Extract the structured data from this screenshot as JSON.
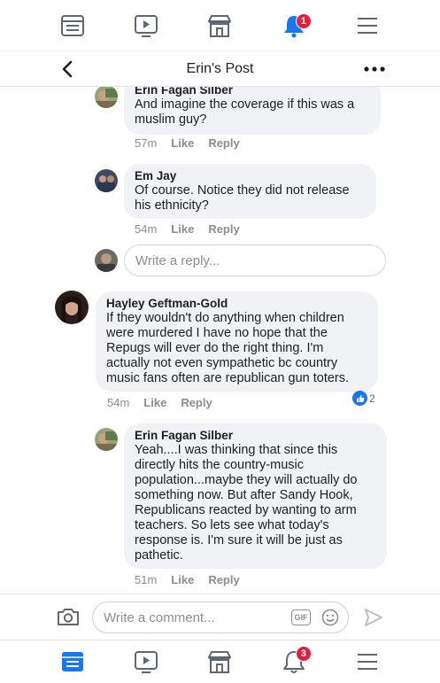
{
  "top_nav": {
    "items": [
      {
        "name": "news-feed",
        "icon": "news-feed-icon",
        "active": false
      },
      {
        "name": "watch",
        "icon": "video-play-icon",
        "active": false
      },
      {
        "name": "marketplace",
        "icon": "marketplace-store-icon",
        "active": false
      },
      {
        "name": "notifications",
        "icon": "bell-icon",
        "active": true,
        "badge": "1"
      },
      {
        "name": "menu",
        "icon": "hamburger-menu-icon",
        "active": false
      }
    ]
  },
  "header": {
    "title": "Erin's Post",
    "back_icon": "chevron-left-icon",
    "more_icon": "more-dots-icon"
  },
  "comments": [
    {
      "author": "Erin Fagan Silber",
      "lines": [
        "And imagine the coverage if this was a",
        "muslim guy?"
      ],
      "time": "57m",
      "like_label": "Like",
      "reply_label": "Reply"
    },
    {
      "author": "Em Jay",
      "lines": [
        "Of course. Notice they did not release",
        "his ethnicity?"
      ],
      "time": "54m",
      "like_label": "Like",
      "reply_label": "Reply"
    },
    {
      "author": "Hayley Geftman-Gold",
      "lines": [
        "If they wouldn't do anything when children",
        "were murdered I have no hope that the",
        "Repugs will ever do the right thing.  I'm",
        "actually not even sympathetic bc country",
        "music fans often are republican gun toters."
      ],
      "time": "54m",
      "like_label": "Like",
      "reply_label": "Reply",
      "reaction_count": "2"
    },
    {
      "author": "Erin Fagan Silber",
      "lines": [
        "Yeah....I was thinking that since this",
        "directly hits the country-music",
        "population...maybe they will actually do",
        "something now.  But after Sandy Hook,",
        "Republicans reacted by wanting to arm",
        "teachers.  So lets see what today's",
        "response is.  I'm sure it will be just as",
        "pathetic."
      ],
      "time": "51m",
      "like_label": "Like",
      "reply_label": "Reply"
    }
  ],
  "reply_box": {
    "placeholder": "Write a reply..."
  },
  "composer": {
    "placeholder": "Write a comment...",
    "gif_label": "GIF",
    "camera_icon": "camera-icon",
    "emoji_icon": "emoji-smile-icon",
    "send_icon": "send-arrow-icon"
  },
  "bottom_nav": {
    "items": [
      {
        "name": "news-feed",
        "icon": "news-feed-icon",
        "active": true
      },
      {
        "name": "watch",
        "icon": "video-play-icon",
        "active": false
      },
      {
        "name": "marketplace",
        "icon": "marketplace-store-icon",
        "active": false
      },
      {
        "name": "notifications",
        "icon": "bell-icon",
        "active": false,
        "badge": "3"
      },
      {
        "name": "menu",
        "icon": "hamburger-menu-icon",
        "active": false
      }
    ]
  },
  "colors": {
    "accent": "#1877f2",
    "badge": "#e41e3f",
    "bubble": "#f0f2f5",
    "muted": "#8a8d91"
  }
}
